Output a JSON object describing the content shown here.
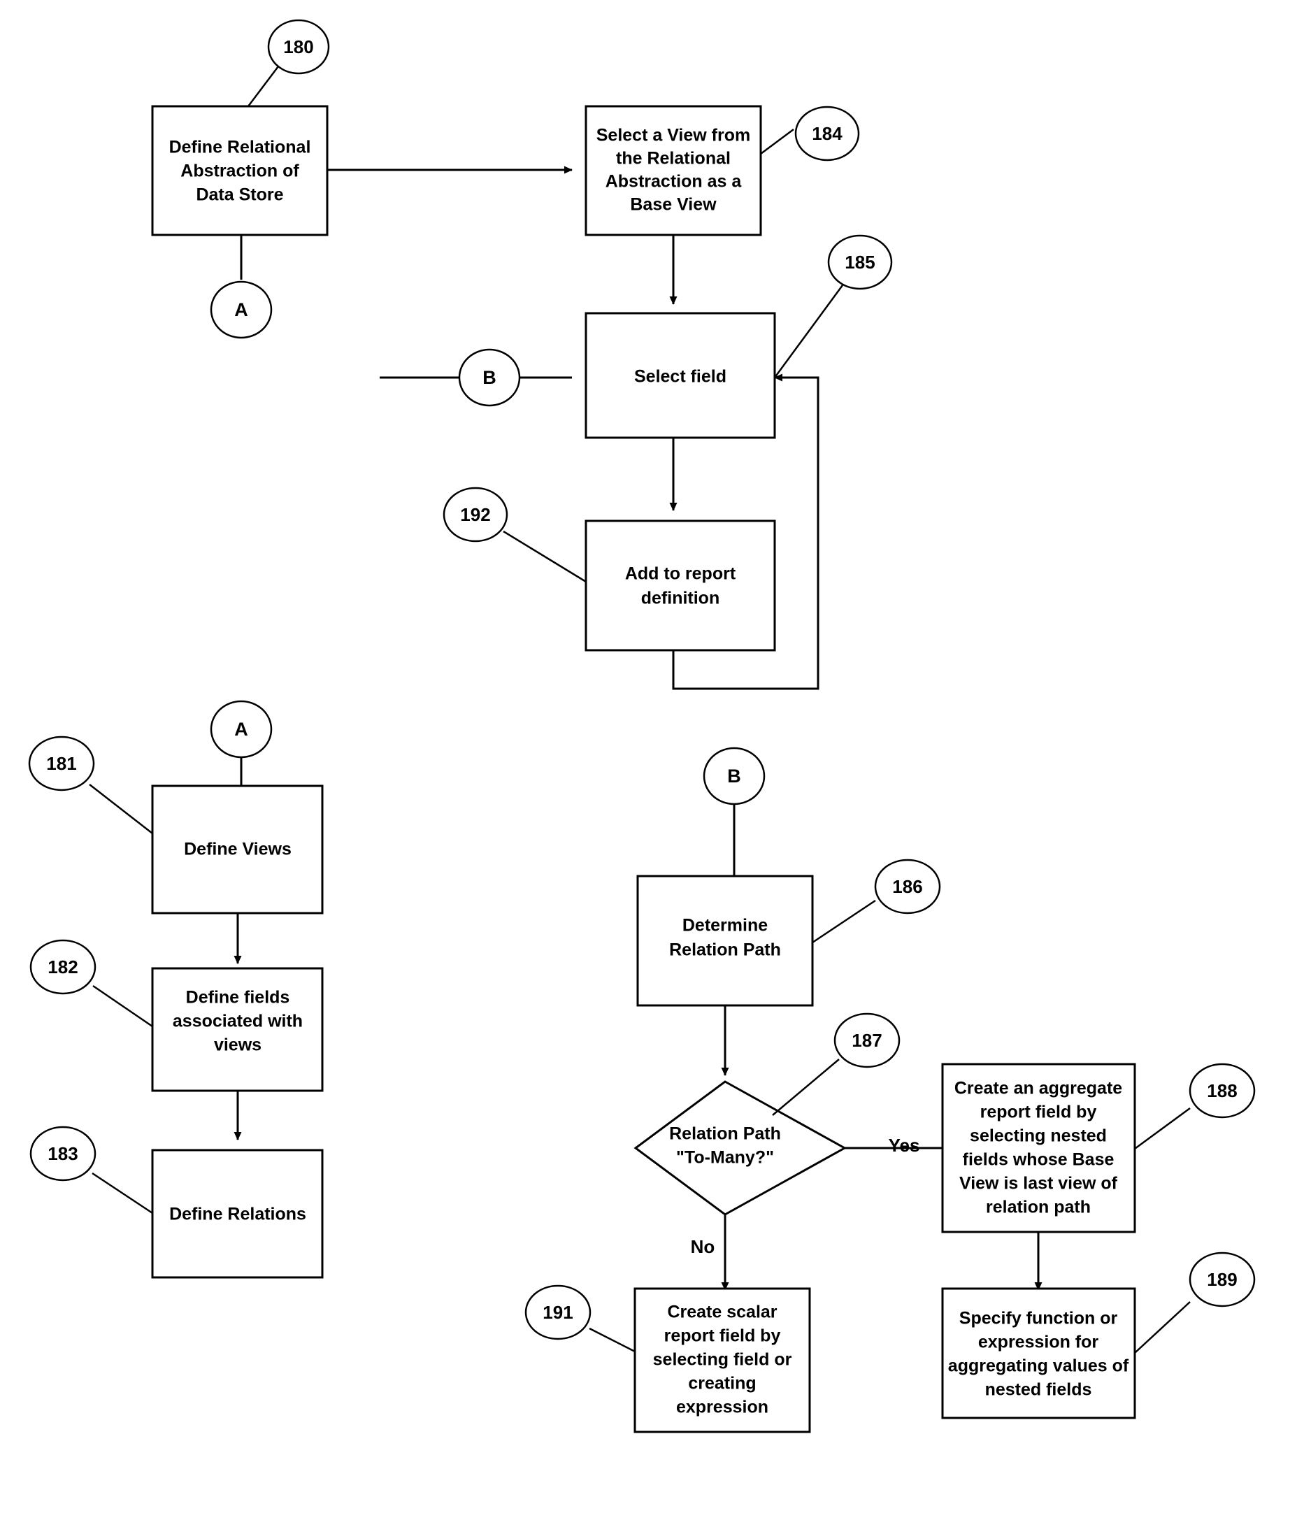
{
  "diagram": {
    "type": "flowchart",
    "title": "",
    "background_color": "#ffffff",
    "stroke_color": "#000000",
    "nodes": [
      {
        "id": "n180",
        "ref": "180",
        "shape": "process",
        "label_lines": [
          "Define Relational",
          "Abstraction of",
          "Data Store"
        ]
      },
      {
        "id": "n184",
        "ref": "184",
        "shape": "process",
        "label_lines": [
          "Select a View from",
          "the Relational",
          "Abstraction as a",
          "Base View"
        ]
      },
      {
        "id": "n185",
        "ref": "185",
        "shape": "process",
        "label_lines": [
          "Select field"
        ]
      },
      {
        "id": "n192",
        "ref": "192",
        "shape": "process",
        "label_lines": [
          "Add to report",
          "definition"
        ]
      },
      {
        "id": "n181",
        "ref": "181",
        "shape": "process",
        "label_lines": [
          "Define Views"
        ]
      },
      {
        "id": "n182",
        "ref": "182",
        "shape": "process",
        "label_lines": [
          "Define fields",
          "associated with",
          "views"
        ]
      },
      {
        "id": "n183",
        "ref": "183",
        "shape": "process",
        "label_lines": [
          "Define Relations"
        ]
      },
      {
        "id": "n186",
        "ref": "186",
        "shape": "process",
        "label_lines": [
          "Determine",
          "Relation Path"
        ]
      },
      {
        "id": "n187",
        "ref": "187",
        "shape": "decision",
        "label_lines": [
          "Relation Path",
          "\"To-Many?\""
        ]
      },
      {
        "id": "n188",
        "ref": "188",
        "shape": "process",
        "label_lines": [
          "Create an aggregate",
          "report field by",
          "selecting nested",
          "fields whose Base",
          "View is last view of",
          "relation path"
        ]
      },
      {
        "id": "n189",
        "ref": "189",
        "shape": "process",
        "label_lines": [
          "Specify function or",
          "expression for",
          "aggregating values of",
          "nested fields"
        ]
      },
      {
        "id": "n191",
        "ref": "191",
        "shape": "process",
        "label_lines": [
          "Create scalar",
          "report field by",
          "selecting field or",
          "creating",
          "expression"
        ]
      }
    ],
    "connectors": [
      {
        "id": "cA_out",
        "label": "A",
        "role": "off-page-connector-exit"
      },
      {
        "id": "cA_in",
        "label": "A",
        "role": "off-page-connector-entry"
      },
      {
        "id": "cB_out",
        "label": "B",
        "role": "off-page-connector-entry"
      },
      {
        "id": "cB_in",
        "label": "B",
        "role": "off-page-connector-exit"
      }
    ],
    "edge_labels": {
      "yes": "Yes",
      "no": "No"
    },
    "reference_numerals": [
      "180",
      "181",
      "182",
      "183",
      "184",
      "185",
      "186",
      "187",
      "188",
      "189",
      "191",
      "192"
    ]
  }
}
